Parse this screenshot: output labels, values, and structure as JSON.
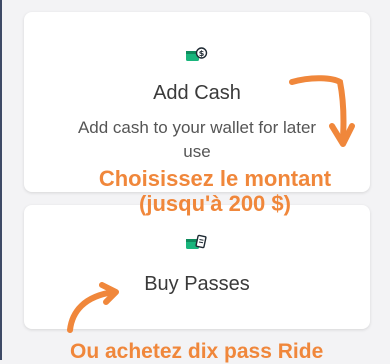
{
  "cards": [
    {
      "icon": "wallet-cash-icon",
      "title": "Add Cash",
      "description": "Add cash to your wallet for later use"
    },
    {
      "icon": "wallet-ticket-icon",
      "title": "Buy Passes"
    }
  ],
  "annotations": {
    "amount_line1": "Choisissez le montant",
    "amount_line2": "(jusqu'à 200 $)",
    "passes": "Ou achetez dix pass Ride"
  },
  "colors": {
    "accent_green": "#19b57c",
    "annotation_orange": "#f0873b"
  }
}
